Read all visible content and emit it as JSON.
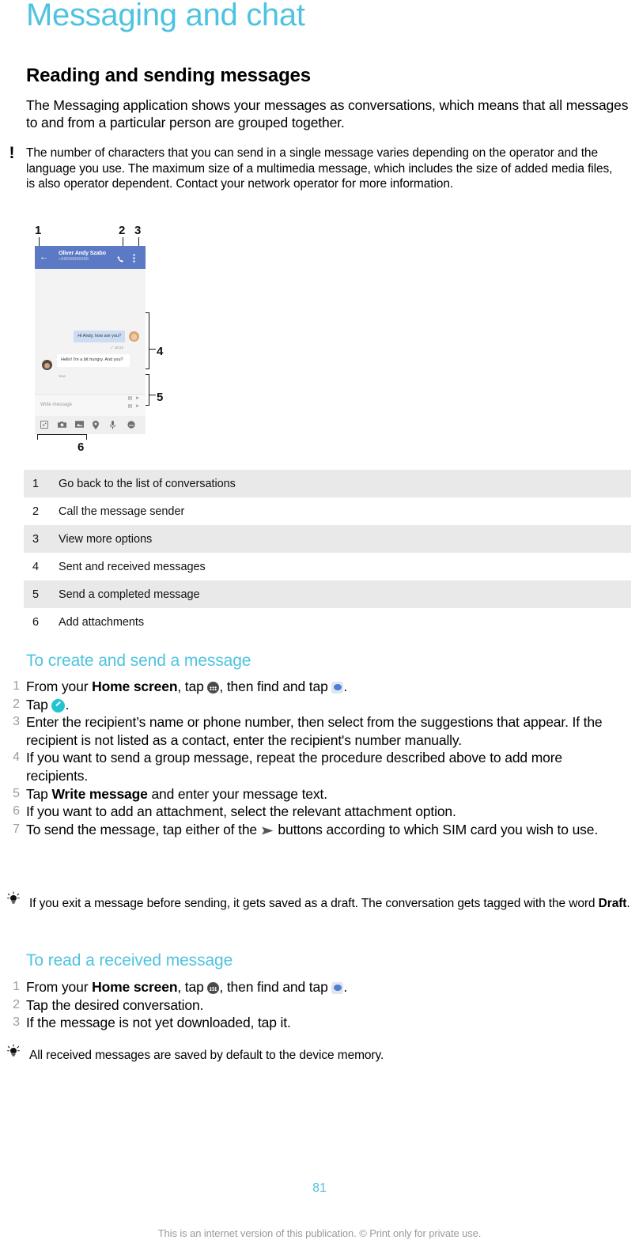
{
  "document": {
    "chapter_title": "Messaging and chat",
    "section_title": "Reading and sending messages",
    "intro_paragraph": "The Messaging application shows your messages as conversations, which means that all messages to and from a particular person are grouped together.",
    "caution_note": "The number of characters that you can send in a single message varies depending on the operator and the language you use. The maximum size of a multimedia message, which includes the size of added media files, is also operator dependent. Contact your network operator for more information.",
    "page_number": "81",
    "footer": "This is an internet version of this publication. © Print only for private use."
  },
  "figure": {
    "callouts": [
      "1",
      "2",
      "3",
      "4",
      "5",
      "6"
    ],
    "phone": {
      "contact_name": "Oliver Andy Szabo",
      "contact_number": "+88888888888",
      "sent_message": "Hi Andy, how are you?",
      "sent_meta": "✓ 18:22",
      "received_message": "Hello! I'm a bit hungry. And you?",
      "received_meta": "Now",
      "compose_placeholder": "Write message",
      "send_label_sim1": "▤ ➤",
      "send_label_sim2": "▤ ➤",
      "attachment_icons": [
        "sticker-icon",
        "camera-icon",
        "photo-icon",
        "location-icon",
        "microphone-icon",
        "emoji-icon"
      ]
    }
  },
  "reference_table": {
    "rows": [
      {
        "num": "1",
        "desc": "Go back to the list of conversations"
      },
      {
        "num": "2",
        "desc": "Call the message sender"
      },
      {
        "num": "3",
        "desc": "View more options"
      },
      {
        "num": "4",
        "desc": "Sent and received messages"
      },
      {
        "num": "5",
        "desc": "Send a completed message"
      },
      {
        "num": "6",
        "desc": "Add attachments"
      }
    ]
  },
  "create_section": {
    "heading": "To create and send a message",
    "steps": [
      {
        "num": "1",
        "prefix": "From your ",
        "bold": "Home screen",
        "mid": ", tap ",
        "icon1": "app-drawer-icon",
        "mid2": ", then find and tap ",
        "icon2": "messaging-icon",
        "suffix": "."
      },
      {
        "num": "2",
        "prefix": "Tap ",
        "icon1": "compose-icon",
        "suffix": "."
      },
      {
        "num": "3",
        "text": "Enter the recipient’s name or phone number, then select from the suggestions that appear. If the recipient is not listed as a contact, enter the recipient's number manually."
      },
      {
        "num": "4",
        "text": "If you want to send a group message, repeat the procedure described above to add more recipients."
      },
      {
        "num": "5",
        "prefix": "Tap ",
        "bold": "Write message",
        "suffix": " and enter your message text."
      },
      {
        "num": "6",
        "text": "If you want to add an attachment, select the relevant attachment option."
      },
      {
        "num": "7",
        "prefix": "To send the message, tap either of the ",
        "icon1": "send-arrow-icon",
        "suffix": " buttons according to which SIM card you wish to use."
      }
    ],
    "tip_prefix": "If you exit a message before sending, it gets saved as a draft. The conversation gets tagged with the word ",
    "tip_bold": "Draft",
    "tip_suffix": "."
  },
  "read_section": {
    "heading": "To read a received message",
    "steps": [
      {
        "num": "1",
        "prefix": "From your ",
        "bold": "Home screen",
        "mid": ", tap ",
        "icon1": "app-drawer-icon",
        "mid2": ", then find and tap ",
        "icon2": "messaging-icon",
        "suffix": "."
      },
      {
        "num": "2",
        "text": "Tap the desired conversation."
      },
      {
        "num": "3",
        "text": "If the message is not yet downloaded, tap it."
      }
    ],
    "tip": "All received messages are saved by default to the device memory."
  },
  "colors": {
    "accent": "#4ec3e0",
    "compose_icon": "#23c4d2",
    "appbar": "#5b79c4",
    "table_stripe": "#e9e9e9"
  }
}
